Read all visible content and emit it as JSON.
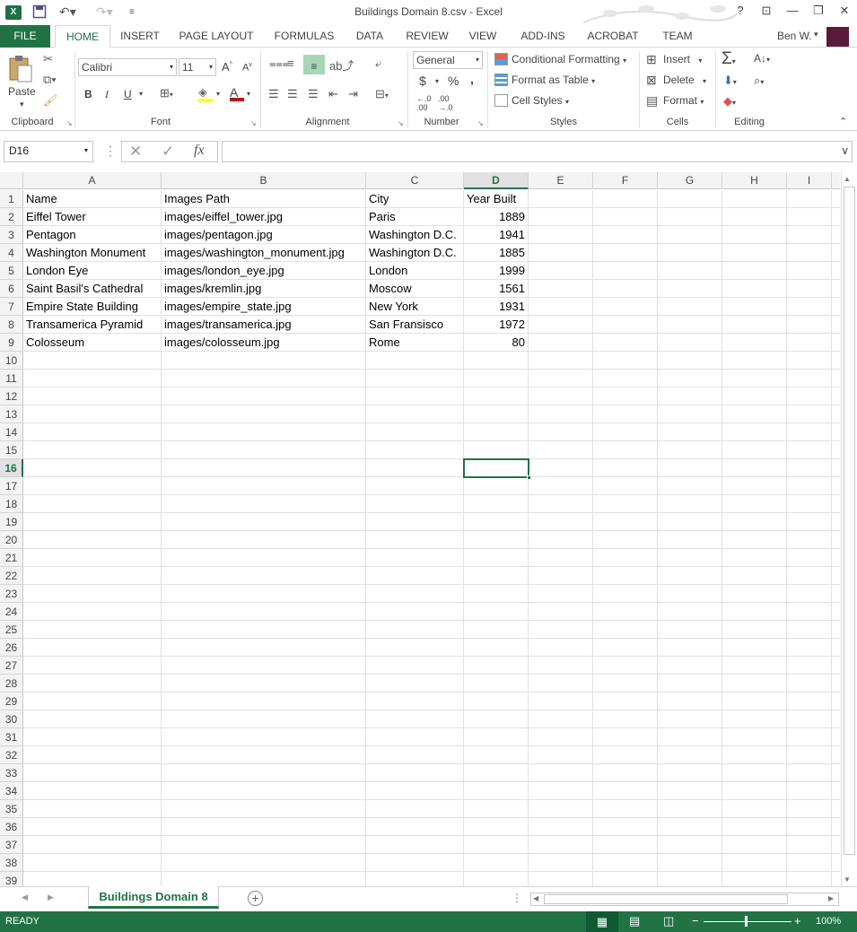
{
  "window": {
    "title": "Buildings Domain 8.csv - Excel",
    "app_icon": "X",
    "help": "?",
    "minimize": "—",
    "restore": "❐",
    "close": "✕"
  },
  "ribbon_tabs": [
    {
      "label": "FILE"
    },
    {
      "label": "HOME"
    },
    {
      "label": "INSERT"
    },
    {
      "label": "PAGE LAYOUT"
    },
    {
      "label": "FORMULAS"
    },
    {
      "label": "DATA"
    },
    {
      "label": "REVIEW"
    },
    {
      "label": "VIEW"
    },
    {
      "label": "ADD-INS"
    },
    {
      "label": "ACROBAT"
    },
    {
      "label": "TEAM"
    }
  ],
  "user": {
    "name": "Ben W."
  },
  "ribbon": {
    "clipboard": {
      "label": "Clipboard",
      "paste": "Paste"
    },
    "font": {
      "label": "Font",
      "family": "Calibri",
      "size": "11",
      "bold": "B",
      "italic": "I",
      "underline": "U"
    },
    "alignment": {
      "label": "Alignment"
    },
    "number": {
      "label": "Number",
      "format": "General",
      "currency": "$",
      "percent": "%",
      "comma": ","
    },
    "styles": {
      "label": "Styles",
      "conditional": "Conditional Formatting",
      "format_table": "Format as Table",
      "cell_styles": "Cell Styles"
    },
    "cells": {
      "label": "Cells",
      "insert": "Insert",
      "delete": "Delete",
      "format": "Format"
    },
    "editing": {
      "label": "Editing"
    }
  },
  "formula_bar": {
    "name_box": "D16",
    "fx": "fx",
    "formula": ""
  },
  "columns": [
    "A",
    "B",
    "C",
    "D",
    "E",
    "F",
    "G",
    "H",
    "I"
  ],
  "rows": [
    [
      "Name",
      "Images Path",
      "City",
      "Year Built"
    ],
    [
      "Eiffel Tower",
      "images/eiffel_tower.jpg",
      "Paris",
      "1889"
    ],
    [
      "Pentagon",
      "images/pentagon.jpg",
      "Washington D.C.",
      "1941"
    ],
    [
      "Washington Monument",
      "images/washington_monument.jpg",
      "Washington D.C.",
      "1885"
    ],
    [
      "London Eye",
      "images/london_eye.jpg",
      "London",
      "1999"
    ],
    [
      "Saint Basil's Cathedral",
      "images/kremlin.jpg",
      "Moscow",
      "1561"
    ],
    [
      "Empire State Building",
      "images/empire_state.jpg",
      "New York",
      "1931"
    ],
    [
      "Transamerica Pyramid",
      "images/transamerica.jpg",
      "San Fransisco",
      "1972"
    ],
    [
      "Colosseum",
      "images/colosseum.jpg",
      "Rome",
      "80"
    ]
  ],
  "selected_cell": "D16",
  "sheet_tab": "Buildings Domain 8",
  "status": {
    "ready": "READY",
    "zoom": "100%"
  },
  "accent_color": "#217346"
}
